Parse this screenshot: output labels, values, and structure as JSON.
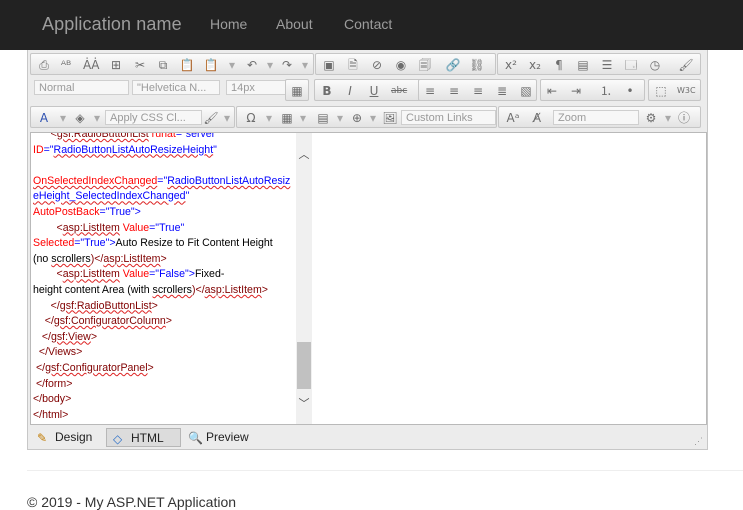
{
  "navbar": {
    "brand": "Application name",
    "links": [
      "Home",
      "About",
      "Contact"
    ],
    "background": "#222222"
  },
  "toolbar": {
    "format_block": "Normal",
    "font_name": "\"Helvetica N...",
    "font_size": "14px",
    "css_class": "Apply CSS Cl...",
    "custom_links": "Custom Links",
    "zoom": "Zoom"
  },
  "code_lines": [
    [
      {
        "t": "      <",
        "c": "t"
      },
      {
        "t": "gsf:RadioButtonList",
        "c": "t u"
      },
      {
        "t": " runat",
        "c": "a"
      },
      {
        "t": "=\"server\"",
        "c": "v"
      }
    ],
    [
      {
        "t": "ID",
        "c": "a"
      },
      {
        "t": "=\"",
        "c": "v"
      },
      {
        "t": "RadioButtonListAutoResizeHeight",
        "c": "v u"
      },
      {
        "t": "\"",
        "c": "v"
      }
    ],
    [
      {
        "t": "",
        "c": ""
      }
    ],
    [
      {
        "t": "OnSelectedIndexChanged",
        "c": "a u"
      },
      {
        "t": "=\"",
        "c": "v"
      },
      {
        "t": "RadioButtonListAutoResiz",
        "c": "v u"
      }
    ],
    [
      {
        "t": "eHeight_SelectedIndexChanged",
        "c": "v u"
      },
      {
        "t": "\"",
        "c": "v"
      }
    ],
    [
      {
        "t": "AutoPostBack",
        "c": "a"
      },
      {
        "t": "=\"True\">",
        "c": "v"
      }
    ],
    [
      {
        "t": "        <",
        "c": "t"
      },
      {
        "t": "asp:ListItem",
        "c": "t u"
      },
      {
        "t": " Value",
        "c": "a"
      },
      {
        "t": "=\"True\"",
        "c": "v"
      }
    ],
    [
      {
        "t": "Selected",
        "c": "a"
      },
      {
        "t": "=\"True\">",
        "c": "v"
      },
      {
        "t": "Auto Resize to Fit Content Height",
        "c": ""
      }
    ],
    [
      {
        "t": "(no ",
        "c": ""
      },
      {
        "t": "scrollers",
        "c": "u"
      },
      {
        "t": ")</",
        "c": "t"
      },
      {
        "t": "asp:ListItem",
        "c": "t u"
      },
      {
        "t": ">",
        "c": "t"
      }
    ],
    [
      {
        "t": "        <",
        "c": "t"
      },
      {
        "t": "asp:ListItem",
        "c": "t u"
      },
      {
        "t": " Value",
        "c": "a"
      },
      {
        "t": "=\"False\">",
        "c": "v"
      },
      {
        "t": "Fixed-",
        "c": ""
      }
    ],
    [
      {
        "t": "height content Area (with ",
        "c": ""
      },
      {
        "t": "scrollers",
        "c": "u"
      },
      {
        "t": ")</",
        "c": "t"
      },
      {
        "t": "asp:ListItem",
        "c": "t u"
      },
      {
        "t": ">",
        "c": "t"
      }
    ],
    [
      {
        "t": "      </",
        "c": "t"
      },
      {
        "t": "gsf:RadioButtonList",
        "c": "t u"
      },
      {
        "t": ">",
        "c": "t"
      }
    ],
    [
      {
        "t": "    </",
        "c": "t"
      },
      {
        "t": "gsf:ConfiguratorColumn",
        "c": "t u"
      },
      {
        "t": ">",
        "c": "t"
      }
    ],
    [
      {
        "t": "   </",
        "c": "t"
      },
      {
        "t": "gsf:View",
        "c": "t u"
      },
      {
        "t": ">",
        "c": "t"
      }
    ],
    [
      {
        "t": "  </Views>",
        "c": "t"
      }
    ],
    [
      {
        "t": " </",
        "c": "t"
      },
      {
        "t": "gsf:ConfiguratorPanel",
        "c": "t u"
      },
      {
        "t": ">",
        "c": "t"
      }
    ],
    [
      {
        "t": " </form>",
        "c": "t"
      }
    ],
    [
      {
        "t": "</body>",
        "c": "t"
      }
    ],
    [
      {
        "t": "</html>",
        "c": "t"
      }
    ]
  ],
  "modes": [
    {
      "label": "Design",
      "icon": "pencil-icon",
      "active": false
    },
    {
      "label": "HTML",
      "icon": "code-icon",
      "active": true
    },
    {
      "label": "Preview",
      "icon": "magnifier-icon",
      "active": false
    }
  ],
  "footer": {
    "text": "© 2019 - My ASP.NET Application"
  }
}
